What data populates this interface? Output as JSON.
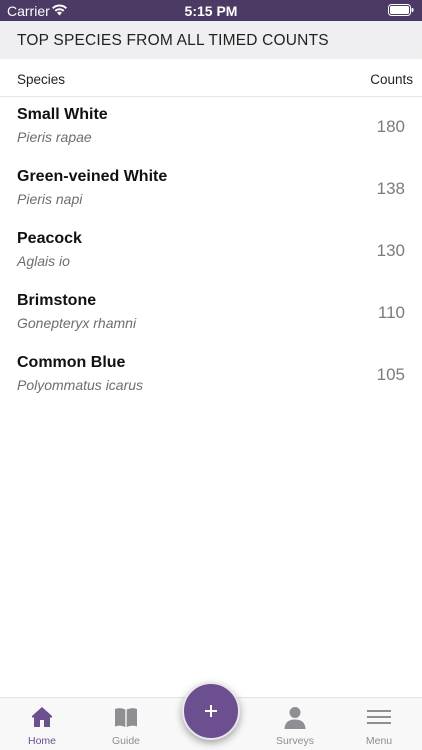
{
  "status_bar": {
    "carrier": "Carrier",
    "time": "5:15 PM"
  },
  "section": {
    "title": "TOP SPECIES FROM ALL TIMED COUNTS"
  },
  "columns": {
    "species": "Species",
    "counts": "Counts"
  },
  "species": [
    {
      "common": "Small White",
      "latin": "Pieris rapae",
      "count": "180"
    },
    {
      "common": "Green-veined White",
      "latin": "Pieris napi",
      "count": "138"
    },
    {
      "common": "Peacock",
      "latin": "Aglais io",
      "count": "130"
    },
    {
      "common": "Brimstone",
      "latin": "Gonepteryx rhamni",
      "count": "110"
    },
    {
      "common": "Common Blue",
      "latin": "Polyommatus icarus",
      "count": "105"
    }
  ],
  "tabs": [
    {
      "label": "Home",
      "icon": "home-icon",
      "active": true
    },
    {
      "label": "Guide",
      "icon": "book-icon",
      "active": false
    },
    {
      "label": "Surveys",
      "icon": "person-icon",
      "active": false
    },
    {
      "label": "Menu",
      "icon": "menu-icon",
      "active": false
    }
  ],
  "fab": {
    "icon": "plus-icon"
  },
  "colors": {
    "brand": "#6b4f8f",
    "status_bar": "#4b3a63",
    "header_bg": "#efeff2",
    "inactive_tab": "#8e8e93"
  }
}
